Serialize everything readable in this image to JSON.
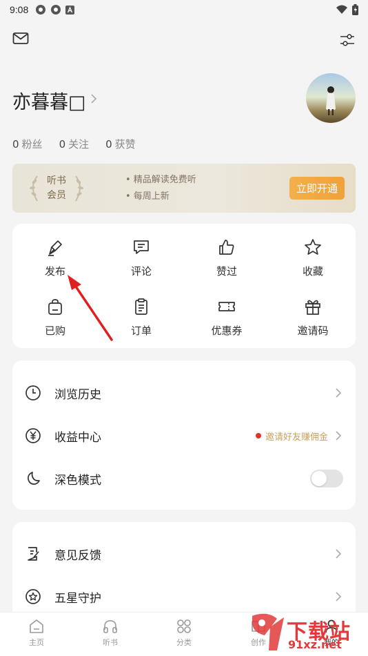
{
  "status_bar": {
    "time": "9:08"
  },
  "profile": {
    "name": "亦暮暮□"
  },
  "stats": [
    {
      "value": "0",
      "label": "粉丝"
    },
    {
      "value": "0",
      "label": "关注"
    },
    {
      "value": "0",
      "label": "获赞"
    }
  ],
  "vip": {
    "badge_line1": "听书",
    "badge_line2": "会员",
    "perk1": "• 精品解读免费听",
    "perk2": "• 每周上新",
    "button": "立即开通"
  },
  "grid": [
    {
      "label": "发布",
      "icon": "pen-icon"
    },
    {
      "label": "评论",
      "icon": "comment-icon"
    },
    {
      "label": "赞过",
      "icon": "thumbs-up-icon"
    },
    {
      "label": "收藏",
      "icon": "star-icon"
    },
    {
      "label": "已购",
      "icon": "bag-icon"
    },
    {
      "label": "订单",
      "icon": "clipboard-icon"
    },
    {
      "label": "优惠券",
      "icon": "ticket-icon"
    },
    {
      "label": "邀请码",
      "icon": "gift-icon"
    }
  ],
  "menu1": {
    "history": "浏览历史",
    "earnings": "收益中心",
    "earnings_promo": "邀请好友赚佣金",
    "dark_mode": "深色模式",
    "dark_mode_on": false
  },
  "menu2": {
    "feedback": "意见反馈",
    "five_star": "五星守护"
  },
  "tabs": [
    {
      "label": "主页",
      "icon": "home-icon"
    },
    {
      "label": "听书",
      "icon": "headphones-icon"
    },
    {
      "label": "分类",
      "icon": "category-icon"
    },
    {
      "label": "创作",
      "icon": "book-icon"
    },
    {
      "label": "我的",
      "icon": "user-icon"
    }
  ],
  "watermark": {
    "brand": "下载站",
    "domain": "91xz.net"
  },
  "colors": {
    "accent": "#f0a13a",
    "promo_text": "#c9a15f",
    "promo_dot": "#e0342a",
    "annotation_arrow": "#e02020"
  }
}
